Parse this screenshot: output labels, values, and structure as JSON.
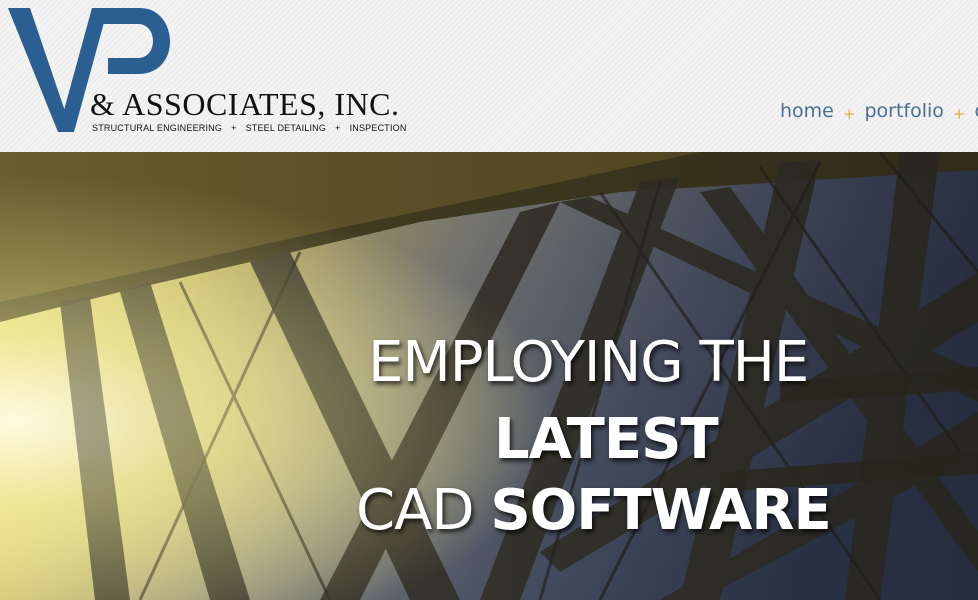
{
  "brand": {
    "monogram": "VP",
    "name": "& ASSOCIATES, INC.",
    "tagline": [
      "STRUCTURAL ENGINEERING",
      "STEEL DETAILING",
      "INSPECTION"
    ],
    "tagline_separator": "+",
    "color": "#2b5f92"
  },
  "nav": {
    "items": [
      {
        "label": "home"
      },
      {
        "label": "portfolio"
      },
      {
        "label": "care"
      }
    ],
    "separator": "+",
    "link_color": "#4a6f96",
    "separator_color": "#e2a93b"
  },
  "hero": {
    "line1": "EMPLOYING THE",
    "line2": "LATEST",
    "line3_light": "CAD",
    "line3_bold": "SOFTWARE",
    "image": "steel-bridge-truss-photo"
  }
}
